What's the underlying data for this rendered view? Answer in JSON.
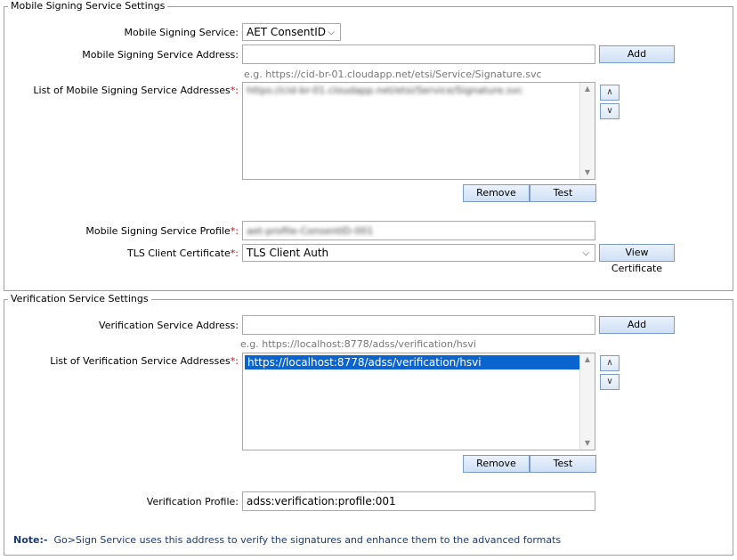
{
  "mobile": {
    "legend": "Mobile Signing Service Settings",
    "service_label": "Mobile Signing Service:",
    "service_value": "AET ConsentID",
    "address_label": "Mobile Signing Service Address:",
    "address_value": "",
    "add_button": "Add",
    "address_hint": "e.g. https://cid-br-01.cloudapp.net/etsi/Service/Signature.svc",
    "list_label": "List of Mobile Signing Service Addresses",
    "list_items": [
      "https://cid-br-01.cloudapp.net/etsi/Service/Signature.svc"
    ],
    "remove_button": "Remove",
    "test_button": "Test",
    "profile_label": "Mobile Signing Service Profile",
    "profile_value": "aet-profile-ConsentID-001",
    "tls_label": "TLS Client Certificate",
    "tls_value": "TLS Client Auth",
    "view_cert_button": "View Certificate"
  },
  "verification": {
    "legend": "Verification Service Settings",
    "address_label": "Verification Service Address:",
    "address_value": "",
    "add_button": "Add",
    "address_hint": "e.g. https://localhost:8778/adss/verification/hsvi",
    "list_label": "List of Verification Service Addresses",
    "list_items": [
      "https://localhost:8778/adss/verification/hsvi"
    ],
    "remove_button": "Remove",
    "test_button": "Test",
    "profile_label": "Verification Profile:",
    "profile_value": "adss:verification:profile:001"
  },
  "note": {
    "label": "Note:-",
    "text": "Go>Sign Service uses this address to verify the signatures and enhance them to the advanced formats"
  },
  "required_marker": "*:",
  "icons": {
    "up": "arrow-up-icon",
    "down": "arrow-down-icon",
    "dropdown": "chevron-down-icon"
  },
  "colors": {
    "required": "#e00000",
    "selection": "#0a64d0",
    "note": "#1f3a6e"
  }
}
